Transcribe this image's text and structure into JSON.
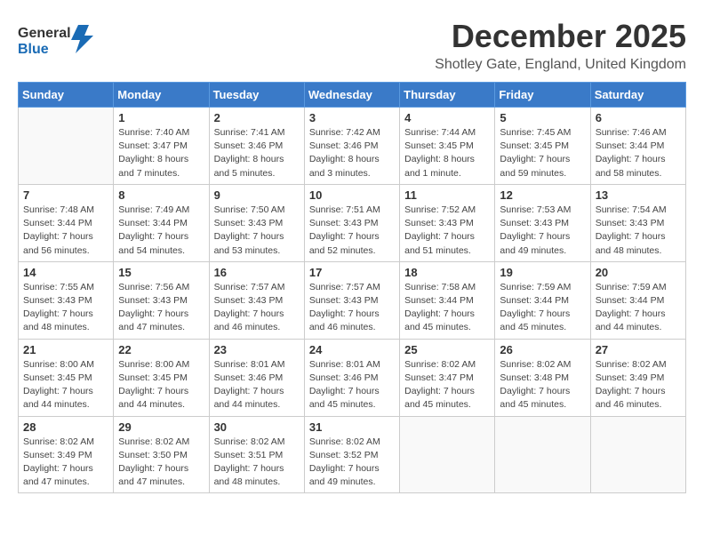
{
  "logo": {
    "general": "General",
    "blue": "Blue"
  },
  "title": "December 2025",
  "subtitle": "Shotley Gate, England, United Kingdom",
  "weekdays": [
    "Sunday",
    "Monday",
    "Tuesday",
    "Wednesday",
    "Thursday",
    "Friday",
    "Saturday"
  ],
  "weeks": [
    [
      {
        "day": "",
        "info": ""
      },
      {
        "day": "1",
        "info": "Sunrise: 7:40 AM\nSunset: 3:47 PM\nDaylight: 8 hours\nand 7 minutes."
      },
      {
        "day": "2",
        "info": "Sunrise: 7:41 AM\nSunset: 3:46 PM\nDaylight: 8 hours\nand 5 minutes."
      },
      {
        "day": "3",
        "info": "Sunrise: 7:42 AM\nSunset: 3:46 PM\nDaylight: 8 hours\nand 3 minutes."
      },
      {
        "day": "4",
        "info": "Sunrise: 7:44 AM\nSunset: 3:45 PM\nDaylight: 8 hours\nand 1 minute."
      },
      {
        "day": "5",
        "info": "Sunrise: 7:45 AM\nSunset: 3:45 PM\nDaylight: 7 hours\nand 59 minutes."
      },
      {
        "day": "6",
        "info": "Sunrise: 7:46 AM\nSunset: 3:44 PM\nDaylight: 7 hours\nand 58 minutes."
      }
    ],
    [
      {
        "day": "7",
        "info": "Sunrise: 7:48 AM\nSunset: 3:44 PM\nDaylight: 7 hours\nand 56 minutes."
      },
      {
        "day": "8",
        "info": "Sunrise: 7:49 AM\nSunset: 3:44 PM\nDaylight: 7 hours\nand 54 minutes."
      },
      {
        "day": "9",
        "info": "Sunrise: 7:50 AM\nSunset: 3:43 PM\nDaylight: 7 hours\nand 53 minutes."
      },
      {
        "day": "10",
        "info": "Sunrise: 7:51 AM\nSunset: 3:43 PM\nDaylight: 7 hours\nand 52 minutes."
      },
      {
        "day": "11",
        "info": "Sunrise: 7:52 AM\nSunset: 3:43 PM\nDaylight: 7 hours\nand 51 minutes."
      },
      {
        "day": "12",
        "info": "Sunrise: 7:53 AM\nSunset: 3:43 PM\nDaylight: 7 hours\nand 49 minutes."
      },
      {
        "day": "13",
        "info": "Sunrise: 7:54 AM\nSunset: 3:43 PM\nDaylight: 7 hours\nand 48 minutes."
      }
    ],
    [
      {
        "day": "14",
        "info": "Sunrise: 7:55 AM\nSunset: 3:43 PM\nDaylight: 7 hours\nand 48 minutes."
      },
      {
        "day": "15",
        "info": "Sunrise: 7:56 AM\nSunset: 3:43 PM\nDaylight: 7 hours\nand 47 minutes."
      },
      {
        "day": "16",
        "info": "Sunrise: 7:57 AM\nSunset: 3:43 PM\nDaylight: 7 hours\nand 46 minutes."
      },
      {
        "day": "17",
        "info": "Sunrise: 7:57 AM\nSunset: 3:43 PM\nDaylight: 7 hours\nand 46 minutes."
      },
      {
        "day": "18",
        "info": "Sunrise: 7:58 AM\nSunset: 3:44 PM\nDaylight: 7 hours\nand 45 minutes."
      },
      {
        "day": "19",
        "info": "Sunrise: 7:59 AM\nSunset: 3:44 PM\nDaylight: 7 hours\nand 45 minutes."
      },
      {
        "day": "20",
        "info": "Sunrise: 7:59 AM\nSunset: 3:44 PM\nDaylight: 7 hours\nand 44 minutes."
      }
    ],
    [
      {
        "day": "21",
        "info": "Sunrise: 8:00 AM\nSunset: 3:45 PM\nDaylight: 7 hours\nand 44 minutes."
      },
      {
        "day": "22",
        "info": "Sunrise: 8:00 AM\nSunset: 3:45 PM\nDaylight: 7 hours\nand 44 minutes."
      },
      {
        "day": "23",
        "info": "Sunrise: 8:01 AM\nSunset: 3:46 PM\nDaylight: 7 hours\nand 44 minutes."
      },
      {
        "day": "24",
        "info": "Sunrise: 8:01 AM\nSunset: 3:46 PM\nDaylight: 7 hours\nand 45 minutes."
      },
      {
        "day": "25",
        "info": "Sunrise: 8:02 AM\nSunset: 3:47 PM\nDaylight: 7 hours\nand 45 minutes."
      },
      {
        "day": "26",
        "info": "Sunrise: 8:02 AM\nSunset: 3:48 PM\nDaylight: 7 hours\nand 45 minutes."
      },
      {
        "day": "27",
        "info": "Sunrise: 8:02 AM\nSunset: 3:49 PM\nDaylight: 7 hours\nand 46 minutes."
      }
    ],
    [
      {
        "day": "28",
        "info": "Sunrise: 8:02 AM\nSunset: 3:49 PM\nDaylight: 7 hours\nand 47 minutes."
      },
      {
        "day": "29",
        "info": "Sunrise: 8:02 AM\nSunset: 3:50 PM\nDaylight: 7 hours\nand 47 minutes."
      },
      {
        "day": "30",
        "info": "Sunrise: 8:02 AM\nSunset: 3:51 PM\nDaylight: 7 hours\nand 48 minutes."
      },
      {
        "day": "31",
        "info": "Sunrise: 8:02 AM\nSunset: 3:52 PM\nDaylight: 7 hours\nand 49 minutes."
      },
      {
        "day": "",
        "info": ""
      },
      {
        "day": "",
        "info": ""
      },
      {
        "day": "",
        "info": ""
      }
    ]
  ]
}
